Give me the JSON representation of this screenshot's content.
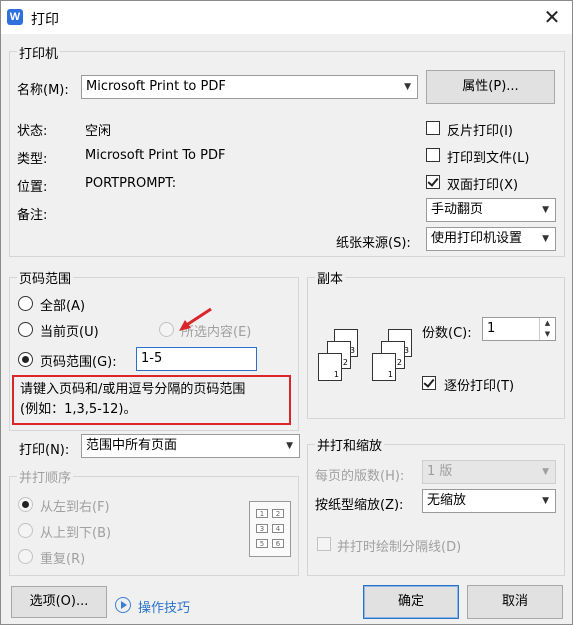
{
  "window": {
    "title": "打印",
    "app_icon": "W",
    "close": "✕"
  },
  "printer": {
    "group_title": "打印机",
    "name_label": "名称(M):",
    "name_value": "Microsoft Print to PDF",
    "properties_button": "属性(P)...",
    "status_label": "状态:",
    "status_value": "空闲",
    "type_label": "类型:",
    "type_value": "Microsoft Print To PDF",
    "location_label": "位置:",
    "location_value": "PORTPROMPT:",
    "comment_label": "备注:",
    "reverse_print": {
      "label": "反片打印(I)",
      "checked": false
    },
    "print_to_file": {
      "label": "打印到文件(L)",
      "checked": false
    },
    "duplex": {
      "label": "双面打印(X)",
      "checked": true
    },
    "duplex_mode": "手动翻页",
    "paper_source_label": "纸张来源(S):",
    "paper_source_value": "使用打印机设置"
  },
  "page_range": {
    "group_title": "页码范围",
    "all": "全部(A)",
    "current_page": "当前页(U)",
    "selection": "所选内容(E)",
    "pages": "页码范围(G):",
    "pages_value": "1-5",
    "hint": "请键入页码和/或用逗号分隔的页码范围\n(例如：1,3,5-12)。"
  },
  "copies": {
    "group_title": "副本",
    "count_label": "份数(C):",
    "count_value": "1",
    "collate": {
      "label": "逐份打印(T)",
      "checked": true
    },
    "page_icons_a": [
      "1",
      "2",
      "3"
    ],
    "page_icons_b": [
      "1",
      "2",
      "3"
    ]
  },
  "print_what": {
    "label": "打印(N):",
    "value": "范围中所有页面"
  },
  "print_order": {
    "group_title": "并打顺序",
    "left_to_right": "从左到右(F)",
    "top_to_bottom": "从上到下(B)",
    "repeat": "重复(R)",
    "grid": [
      "1",
      "2",
      "3",
      "4",
      "5",
      "6"
    ]
  },
  "zoom": {
    "group_title": "并打和缩放",
    "pages_per_sheet_label": "每页的版数(H):",
    "pages_per_sheet_value": "1 版",
    "scale_label": "按纸型缩放(Z):",
    "scale_value": "无缩放",
    "draw_borders": "并打时绘制分隔线(D)"
  },
  "footer": {
    "options_button": "选项(O)...",
    "tips_link": "操作技巧",
    "ok_button": "确定",
    "cancel_button": "取消"
  },
  "colors": {
    "accent": "#2a72c8",
    "hint_border": "#d9262a",
    "arrow": "#d9262a"
  }
}
